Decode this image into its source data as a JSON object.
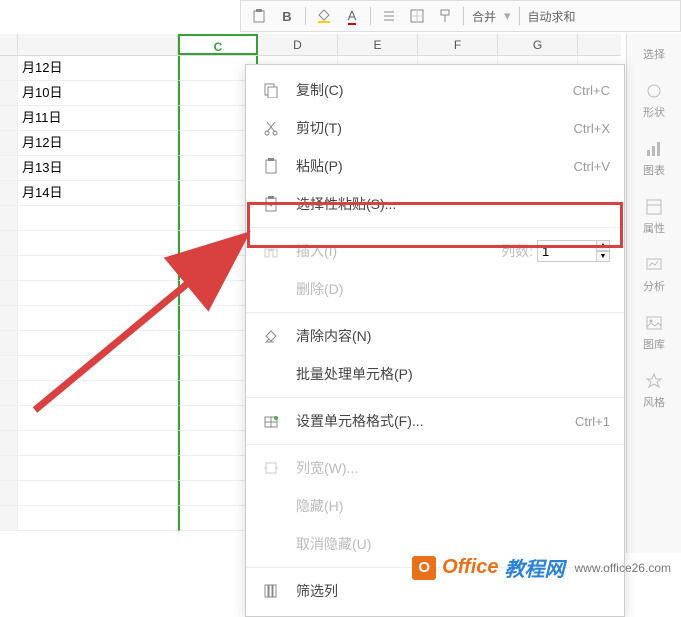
{
  "toolbar": {
    "merge": "合并",
    "autosum": "自动求和"
  },
  "columns": {
    "c": "C",
    "d": "D",
    "e": "E",
    "f": "F",
    "g": "G"
  },
  "rows": [
    "月12日",
    "月10日",
    "月11日",
    "月12日",
    "月13日",
    "月14日"
  ],
  "sidepanel": {
    "select": "选择",
    "shape": "形状",
    "chart": "图表",
    "property": "属性",
    "analysis": "分析",
    "gallery": "图库",
    "style": "风格"
  },
  "menu": {
    "copy": {
      "label": "复制(C)",
      "shortcut": "Ctrl+C"
    },
    "cut": {
      "label": "剪切(T)",
      "shortcut": "Ctrl+X"
    },
    "paste": {
      "label": "粘贴(P)",
      "shortcut": "Ctrl+V"
    },
    "pastespecial": {
      "label": "选择性粘贴(S)..."
    },
    "insert": {
      "label": "插入(I)",
      "cols_label": "列数:",
      "cols_value": "1"
    },
    "delete": {
      "label": "删除(D)"
    },
    "clear": {
      "label": "清除内容(N)"
    },
    "batch": {
      "label": "批量处理单元格(P)"
    },
    "format": {
      "label": "设置单元格格式(F)...",
      "shortcut": "Ctrl+1"
    },
    "colwidth": {
      "label": "列宽(W)..."
    },
    "hide": {
      "label": "隐藏(H)"
    },
    "unhide": {
      "label": "取消隐藏(U)"
    },
    "filter": {
      "label": "筛选列"
    }
  },
  "watermark": {
    "logo": "O",
    "text1": "Office",
    "text2": "教程网",
    "url": "www.office26.com"
  }
}
